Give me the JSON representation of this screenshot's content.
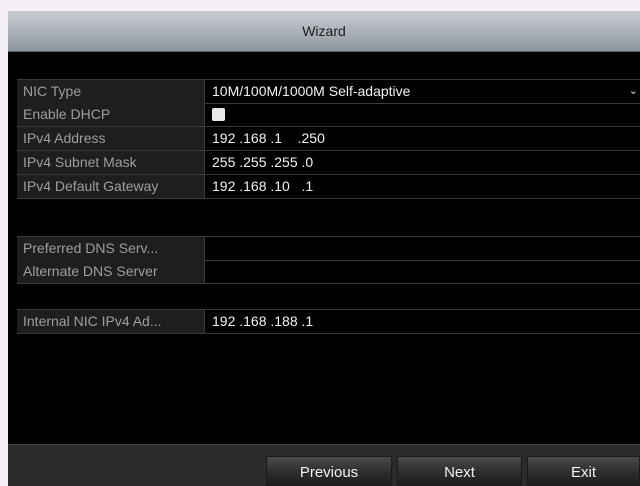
{
  "window": {
    "title": "Wizard"
  },
  "fields": {
    "nic_type": {
      "label": "NIC Type",
      "value": "10M/100M/1000M Self-adaptive"
    },
    "enable_dhcp": {
      "label": "Enable DHCP",
      "checked": false
    },
    "ipv4_address": {
      "label": "IPv4 Address",
      "value": "192 .168 .1    .250"
    },
    "subnet_mask": {
      "label": "IPv4 Subnet Mask",
      "value": "255 .255 .255 .0"
    },
    "gateway": {
      "label": "IPv4 Default Gateway",
      "value": "192 .168 .10   .1"
    },
    "preferred_dns": {
      "label": "Preferred DNS Serv...",
      "value": ""
    },
    "alternate_dns": {
      "label": "Alternate DNS Server",
      "value": ""
    },
    "internal_nic": {
      "label": "Internal NIC IPv4 Ad...",
      "value": "192 .168 .188 .1"
    }
  },
  "buttons": {
    "previous": "Previous",
    "next": "Next",
    "exit": "Exit"
  },
  "icons": {
    "dropdown": "chevron-down-icon"
  }
}
